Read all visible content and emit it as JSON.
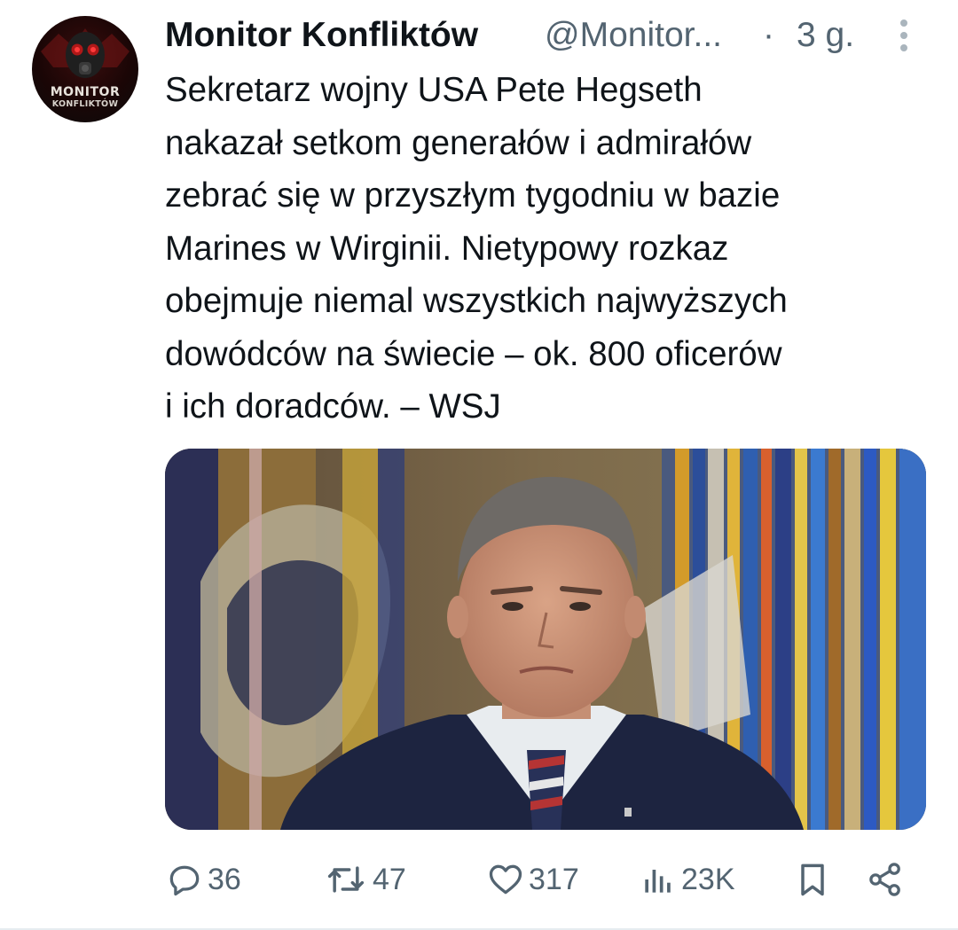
{
  "author": {
    "display_name": "Monitor Konfliktów",
    "handle": "@Monitor...",
    "separator": "·",
    "timestamp": "3 g.",
    "avatar_text_line1": "MONITOR",
    "avatar_text_line2": "KONFLIKTÓW"
  },
  "tweet": {
    "text": "Sekretarz wojny USA Pete Hegseth\nnakazał setkom generałów i admirałów\nzebrać się w przyszłym tygodniu w bazie\nMarines w Wirginii. Nietypowy rozkaz\nobejmuje niemal wszystkich najwyższych\ndowódców na świecie – ok. 800 oficerów\ni ich doradców. – WSJ"
  },
  "actions": {
    "replies": "36",
    "reposts": "47",
    "likes": "317",
    "views": "23K"
  },
  "icons": {
    "more": "more-vertical-icon",
    "reply": "reply-icon",
    "repost": "repost-icon",
    "like": "heart-icon",
    "views": "views-chart-icon",
    "bookmark": "bookmark-icon",
    "share": "share-icon"
  },
  "colors": {
    "text_primary": "#0f1419",
    "text_secondary": "#536471",
    "divider": "#e6ecf0"
  }
}
